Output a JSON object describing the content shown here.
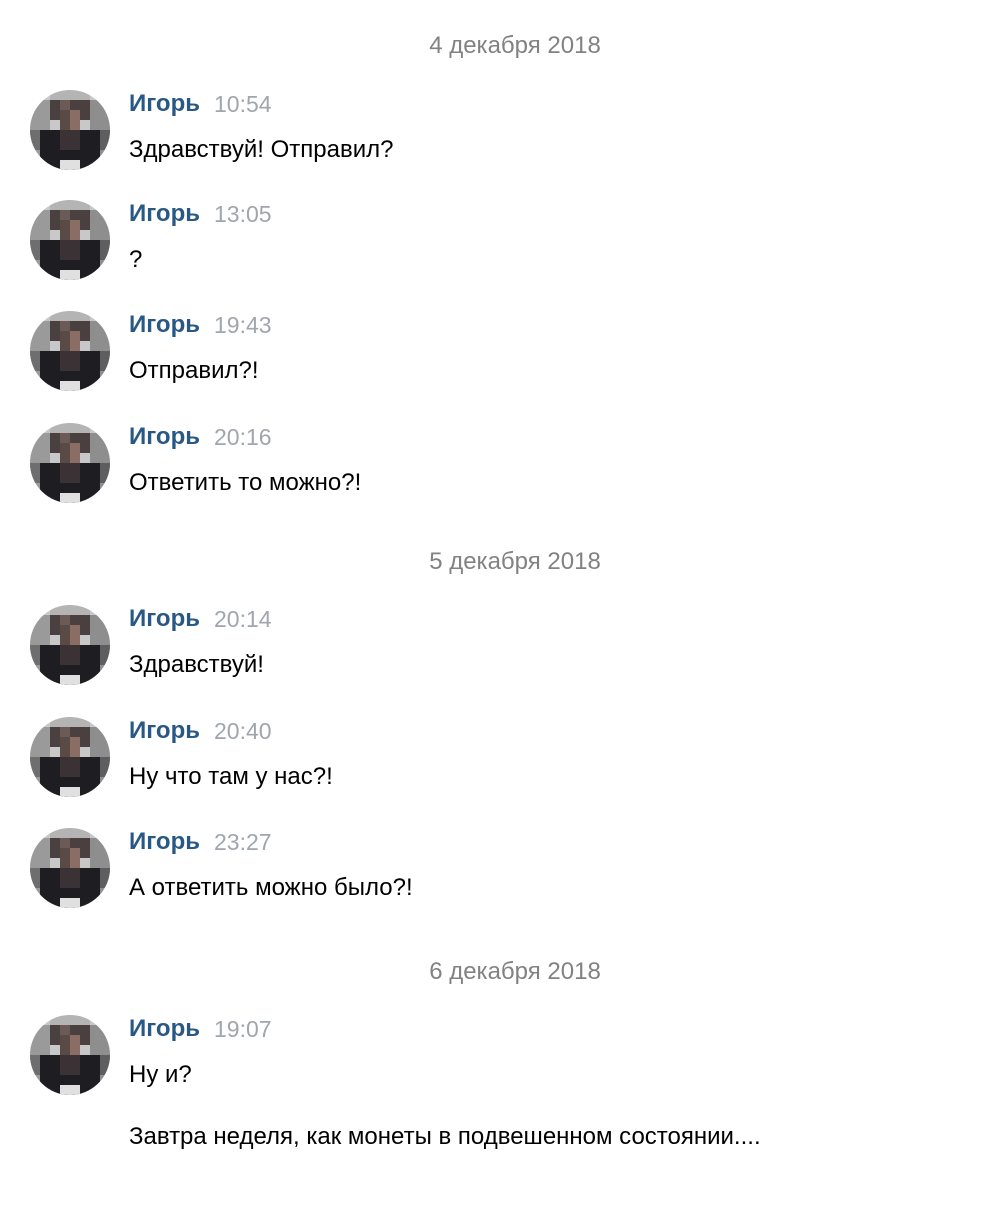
{
  "dates": [
    "4 декабря 2018",
    "5 декабря 2018",
    "6 декабря 2018"
  ],
  "messages": [
    {
      "author": "Игорь",
      "time": "10:54",
      "lines": [
        "Здравствуй! Отправил?"
      ]
    },
    {
      "author": "Игорь",
      "time": "13:05",
      "lines": [
        "?"
      ]
    },
    {
      "author": "Игорь",
      "time": "19:43",
      "lines": [
        "Отправил?!"
      ]
    },
    {
      "author": "Игорь",
      "time": "20:16",
      "lines": [
        "Ответить то можно?!"
      ]
    },
    {
      "author": "Игорь",
      "time": "20:14",
      "lines": [
        "Здравствуй!"
      ]
    },
    {
      "author": "Игорь",
      "time": "20:40",
      "lines": [
        "Ну что там у нас?!"
      ]
    },
    {
      "author": "Игорь",
      "time": "23:27",
      "lines": [
        "А ответить можно было?!"
      ]
    },
    {
      "author": "Игорь",
      "time": "19:07",
      "lines": [
        "Ну и?",
        "Завтра неделя, как монеты в подвешенном состоянии...."
      ]
    }
  ],
  "colors": {
    "author": "#2a5885",
    "time": "#a0a6ad",
    "date": "#828282",
    "text": "#000000"
  }
}
